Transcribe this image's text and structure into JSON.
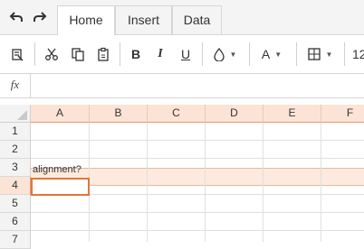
{
  "quick_access": {
    "undo_icon": "undo-icon",
    "redo_icon": "redo-icon"
  },
  "tabs": [
    {
      "label": "Home",
      "active": true
    },
    {
      "label": "Insert",
      "active": false
    },
    {
      "label": "Data",
      "active": false
    }
  ],
  "toolbar": {
    "bold_label": "B",
    "italic_label": "I",
    "underline_label": "U",
    "font_color_label": "A",
    "font_size_value": "12",
    "icons": [
      "clear-format-icon",
      "cut-icon",
      "copy-icon",
      "paste-icon",
      "fill-color-icon",
      "borders-icon"
    ]
  },
  "formula_bar": {
    "fx_label": "fx",
    "value": ""
  },
  "sheet": {
    "columns": [
      "A",
      "B",
      "C",
      "D",
      "E",
      "F"
    ],
    "rows": [
      "1",
      "2",
      "3",
      "4",
      "5",
      "6",
      "7"
    ],
    "cells": {
      "A3": "alignment?"
    },
    "active_cell": "A4",
    "selected_row": "4",
    "accent_color": "#e3743b"
  }
}
